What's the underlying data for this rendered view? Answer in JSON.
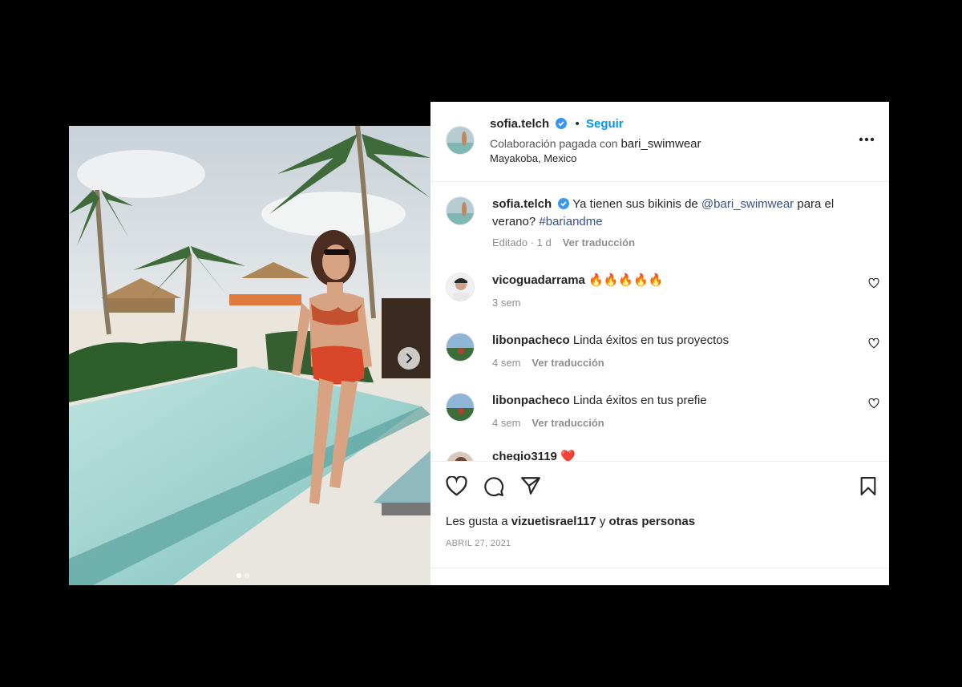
{
  "post": {
    "author": "sofia.telch",
    "dot": "•",
    "follow_label": "Seguir",
    "paid_label": "Colaboración pagada con",
    "partner": "bari_swimwear",
    "location": "Mayakoba, Mexico",
    "more_label": "•••"
  },
  "caption": {
    "author": "sofia.telch",
    "text_before": "Ya tienen sus bikinis de",
    "mention": "@bari_swimwear",
    "text_after": "para el verano?",
    "hashtag": "#bariandme",
    "meta": "Editado · 1 d",
    "translate": "Ver traducción"
  },
  "comments": [
    {
      "user": "vicoguadarrama",
      "text": "🔥🔥🔥🔥🔥",
      "time": "3 sem",
      "translate": ""
    },
    {
      "user": "libonpacheco",
      "text": "Linda éxitos en tus proyectos",
      "time": "4 sem",
      "translate": "Ver traducción"
    },
    {
      "user": "libonpacheco",
      "text": "Linda éxitos en tus prefie",
      "time": "4 sem",
      "translate": "Ver traducción"
    },
    {
      "user": "chegio3119",
      "text": "❤️",
      "time": "",
      "translate": ""
    }
  ],
  "likes": {
    "prefix": "Les gusta a",
    "user": "vizuetisrael117",
    "middle": "y",
    "others": "otras personas"
  },
  "date": "ABRIL 27, 2021",
  "carousel": {
    "slide_count": 2,
    "active_index": 0
  },
  "colors": {
    "follow": "#0095f6",
    "verified": "#3897f0",
    "link": "#385185",
    "muted": "#8e8e8e"
  },
  "icons": [
    "verified-badge-icon",
    "more-options-icon",
    "heart-icon",
    "comment-icon",
    "share-icon",
    "bookmark-icon",
    "chevron-right-icon"
  ]
}
